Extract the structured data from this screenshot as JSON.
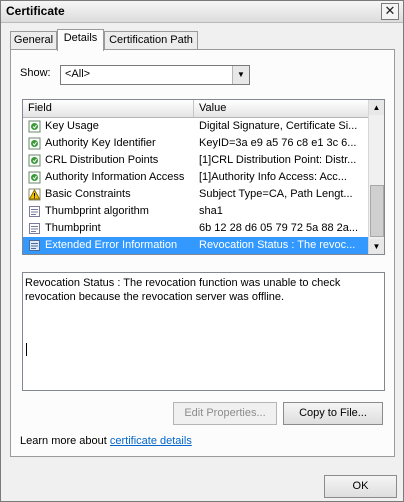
{
  "window": {
    "title": "Certificate"
  },
  "tabs": [
    {
      "label": "General",
      "active": false
    },
    {
      "label": "Details",
      "active": true
    },
    {
      "label": "Certification Path",
      "active": false
    }
  ],
  "show": {
    "label": "Show:",
    "value": "<All>"
  },
  "list": {
    "headers": {
      "field": "Field",
      "value": "Value"
    },
    "rows": [
      {
        "field": "Key Usage",
        "value": "Digital Signature, Certificate Si...",
        "icon": "extension-icon"
      },
      {
        "field": "Authority Key Identifier",
        "value": "KeyID=3a e9 a5 76 c8 e1 3c 6...",
        "icon": "extension-icon"
      },
      {
        "field": "CRL Distribution Points",
        "value": "[1]CRL Distribution Point: Distr...",
        "icon": "extension-icon"
      },
      {
        "field": "Authority Information Access",
        "value": "[1]Authority Info Access: Acc...",
        "icon": "extension-icon"
      },
      {
        "field": "Basic Constraints",
        "value": "Subject Type=CA, Path Lengt...",
        "icon": "critical-extension-icon"
      },
      {
        "field": "Thumbprint algorithm",
        "value": "sha1",
        "icon": "property-icon"
      },
      {
        "field": "Thumbprint",
        "value": "6b 12 28 d6 05 79 72 5a 88 2a...",
        "icon": "property-icon"
      },
      {
        "field": "Extended Error Information",
        "value": "Revocation Status : The revoc...",
        "icon": "error-info-icon"
      }
    ]
  },
  "detail": {
    "text": "Revocation Status : The revocation function was unable to check revocation because the revocation server was offline."
  },
  "buttons": {
    "edit_properties": "Edit Properties...",
    "copy_to_file": "Copy to File...",
    "ok": "OK"
  },
  "learn": {
    "prefix": "Learn more about ",
    "link": "certificate details"
  },
  "colors": {
    "selection": "#3399ff",
    "link": "#0066cc"
  }
}
